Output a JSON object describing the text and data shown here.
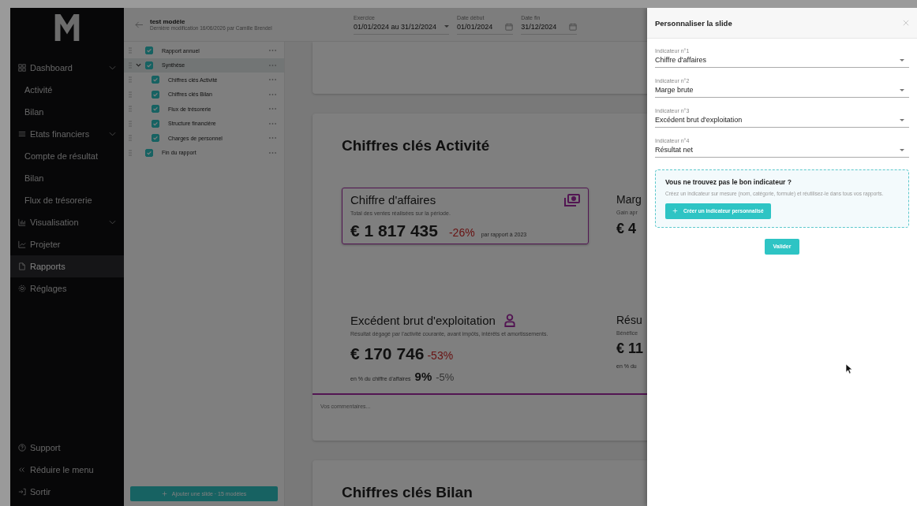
{
  "sidebar": {
    "items": [
      {
        "label": "Dashboard",
        "kind": "group",
        "expanded": true,
        "selected": false
      },
      {
        "label": "Activité",
        "kind": "sub",
        "selected": false
      },
      {
        "label": "Bilan",
        "kind": "sub",
        "selected": false
      },
      {
        "label": "Etats financiers",
        "kind": "group",
        "expanded": true,
        "selected": false
      },
      {
        "label": "Compte de résultat",
        "kind": "sub",
        "selected": false
      },
      {
        "label": "Bilan",
        "kind": "sub",
        "selected": false
      },
      {
        "label": "Flux de trésorerie",
        "kind": "sub",
        "selected": false
      },
      {
        "label": "Visualisation",
        "kind": "group",
        "expanded": true,
        "selected": false
      },
      {
        "label": "Projeter",
        "kind": "link",
        "selected": false
      },
      {
        "label": "Rapports",
        "kind": "link",
        "selected": true
      },
      {
        "label": "Réglages",
        "kind": "link",
        "selected": false
      }
    ],
    "footer": [
      {
        "label": "Support"
      },
      {
        "label": "Réduire le menu"
      },
      {
        "label": "Sortir"
      }
    ]
  },
  "template": {
    "title": "test modèle",
    "subtitle": "Dernière modification 16/06/2026 par Camille Brendel"
  },
  "filters": [
    {
      "label": "Exercice",
      "value": "01/01/2024 au 31/12/2024",
      "kind": "select"
    },
    {
      "label": "Date début",
      "value": "01/01/2024",
      "kind": "date"
    },
    {
      "label": "Date fin",
      "value": "31/12/2024",
      "kind": "date"
    }
  ],
  "outline": {
    "items": [
      {
        "label": "Rapport annuel",
        "checked": true,
        "selected": false
      },
      {
        "label": "Synthèse",
        "checked": true,
        "selected": true,
        "expanded": true,
        "children": [
          {
            "label": "Chiffres clés Activité",
            "checked": true,
            "selected": false
          },
          {
            "label": "Chiffres clés Bilan",
            "checked": true,
            "selected": false
          },
          {
            "label": "Flux de trésorerie",
            "checked": true,
            "selected": false
          },
          {
            "label": "Structure financière",
            "checked": true,
            "selected": false
          },
          {
            "label": "Charges de personnel",
            "checked": true,
            "selected": false
          }
        ]
      },
      {
        "label": "Fin du rapport",
        "checked": true,
        "selected": false
      }
    ],
    "add_button": "Ajouter une slide · 15 modèles"
  },
  "slides": [
    {
      "kind": "blank"
    },
    {
      "kind": "kpis",
      "title": "Chiffres clés Activité",
      "comment_placeholder": "Vos commentaires...",
      "kpis": [
        {
          "title": "Chiffre d'affaires",
          "description": "Total des ventes réalisées sur la période.",
          "value": "€ 1 817 435",
          "change": "-26%",
          "comparison": "par rapport à 2023",
          "selected": true
        },
        {
          "title": "Marg",
          "description": "Gain apr",
          "value": "€ 4",
          "selected": false
        },
        {
          "title": "Excédent brut d'exploitation",
          "description": "Résultat dégagé par l'activité courante, avant impôts, intérêts et amortissements.",
          "value": "€ 170 746",
          "change": "-53%",
          "ratio_label": "en % du chiffre d'affaires",
          "ratio": "9%",
          "ratio_change": "-5%",
          "selected": false
        },
        {
          "title": "Résu",
          "description": "Bénéfice",
          "value": "€ 11",
          "ratio_label": "en % du",
          "selected": false
        }
      ]
    },
    {
      "kind": "heading",
      "title": "Chiffres clés Bilan"
    }
  ],
  "drawer": {
    "title": "Personnaliser la slide",
    "fields": [
      {
        "label": "Indicateur n°1",
        "value": "Chiffre d'affaires"
      },
      {
        "label": "Indicateur n°2",
        "value": "Marge brute"
      },
      {
        "label": "Indicateur n°3",
        "value": "Excédent brut d'exploitation"
      },
      {
        "label": "Indicateur n°4",
        "value": "Résultat net"
      }
    ],
    "hint": {
      "title": "Vous ne trouvez pas le bon indicateur ?",
      "text": "Créez un indicateur sur mesure (nom, catégorie, formule) et réutilisez-le dans tous vos rapports.",
      "button": "Créer un indicateur personnalisé"
    },
    "submit": "Valider"
  }
}
